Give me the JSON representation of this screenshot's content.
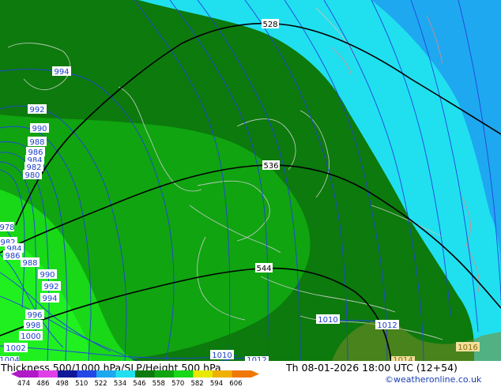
{
  "footer": {
    "title": "Thickness 500/1000 hPa/SLP/Height 500 hPa",
    "datetime": "Th 08-01-2026 18:00 UTC (12+54)",
    "credit": "©weatheronline.co.uk"
  },
  "colorbar": {
    "labels": [
      "474",
      "486",
      "498",
      "510",
      "522",
      "534",
      "546",
      "558",
      "570",
      "582",
      "594",
      "606"
    ],
    "colors": [
      "#b018c8",
      "#e040e8",
      "#101898",
      "#2448e8",
      "#1ea8f0",
      "#20e0f0",
      "#0c7a0c",
      "#10a410",
      "#18d818",
      "#e8e800",
      "#f0b000",
      "#f07808"
    ]
  },
  "thickness_labels": [
    "528",
    "536",
    "544"
  ],
  "slp_labels": [
    "994",
    "992",
    "990",
    "988",
    "986",
    "984",
    "982",
    "980",
    "978",
    "982",
    "984",
    "986",
    "988",
    "990",
    "992",
    "994",
    "996",
    "998",
    "1000",
    "1002",
    "1004",
    "1010",
    "1012",
    "1010",
    "1012",
    "1014",
    "1016"
  ]
}
